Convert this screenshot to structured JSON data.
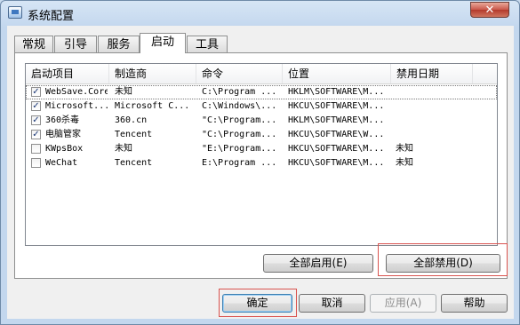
{
  "window": {
    "title": "系统配置",
    "close_glyph": "✕"
  },
  "tabs": [
    {
      "label": "常规"
    },
    {
      "label": "引导"
    },
    {
      "label": "服务"
    },
    {
      "label": "启动",
      "active": true
    },
    {
      "label": "工具"
    }
  ],
  "startup_list": {
    "columns": [
      "启动项目",
      "制造商",
      "命令",
      "位置",
      "禁用日期"
    ],
    "rows": [
      {
        "checked": true,
        "item": "WebSave.Core",
        "vendor": "未知",
        "command": "C:\\Program ...",
        "location": "HKLM\\SOFTWARE\\M...",
        "disabled_date": ""
      },
      {
        "checked": true,
        "item": "Microsoft...",
        "vendor": "Microsoft C...",
        "command": "C:\\Windows\\...",
        "location": "HKCU\\SOFTWARE\\M...",
        "disabled_date": ""
      },
      {
        "checked": true,
        "item": "360杀毒",
        "vendor": "360.cn",
        "command": "\"C:\\Program...",
        "location": "HKLM\\SOFTWARE\\M...",
        "disabled_date": ""
      },
      {
        "checked": true,
        "item": "电脑管家",
        "vendor": "Tencent",
        "command": "\"C:\\Program...",
        "location": "HKCU\\SOFTWARE\\W...",
        "disabled_date": ""
      },
      {
        "checked": false,
        "item": "KWpsBox",
        "vendor": "未知",
        "command": "\"E:\\Program...",
        "location": "HKCU\\SOFTWARE\\M...",
        "disabled_date": "未知"
      },
      {
        "checked": false,
        "item": "WeChat",
        "vendor": "Tencent",
        "command": "E:\\Program ...",
        "location": "HKCU\\SOFTWARE\\M...",
        "disabled_date": "未知"
      }
    ]
  },
  "panel_buttons": {
    "enable_all": "全部启用(E)",
    "disable_all": "全部禁用(D)"
  },
  "dialog_buttons": {
    "ok": "确定",
    "cancel": "取消",
    "apply": "应用(A)",
    "help": "帮助"
  },
  "highlight_color": "#d9534f"
}
